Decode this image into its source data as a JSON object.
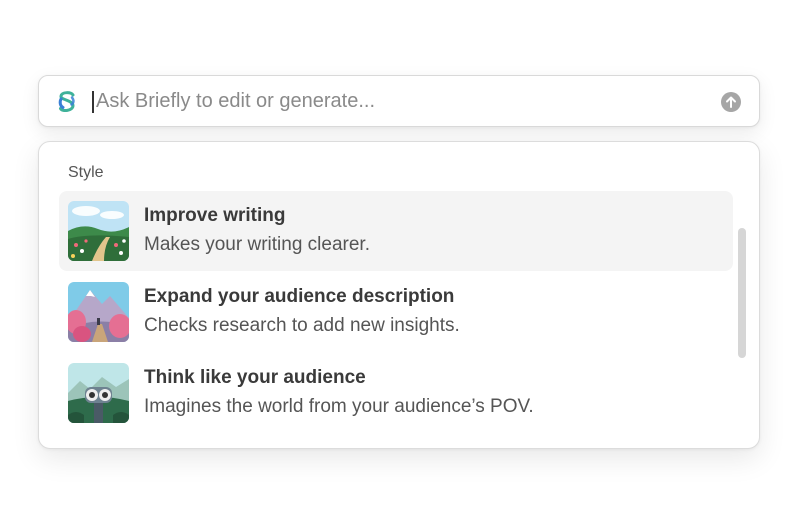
{
  "prompt": {
    "placeholder": "Ask Briefly to edit or generate...",
    "value": ""
  },
  "menu": {
    "section_label": "Style",
    "items": [
      {
        "title": "Improve writing",
        "description": "Makes your writing clearer.",
        "icon": "meadow-path-thumbnail",
        "selected": true
      },
      {
        "title": "Expand your audience description",
        "description": "Checks research to add new insights.",
        "icon": "mountain-flowers-thumbnail",
        "selected": false
      },
      {
        "title": "Think like your audience",
        "description": "Imagines the world from your audience’s POV.",
        "icon": "binocular-viewer-thumbnail",
        "selected": false
      }
    ]
  },
  "colors": {
    "logo_green": "#3fb29a",
    "logo_blue": "#3a7fd6",
    "send_icon": "#a6a6a6",
    "selected_row": "#f4f4f4",
    "scrollbar": "#d6d6d6"
  },
  "icons": [
    "briefly-logo-icon",
    "send-arrow-icon"
  ]
}
